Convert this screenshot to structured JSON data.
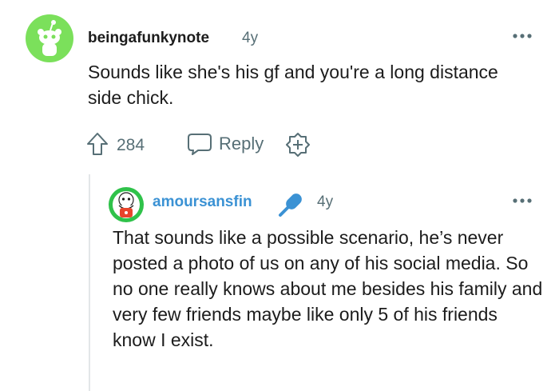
{
  "comment": {
    "author": "beingafunkynote",
    "age": "4y",
    "body": "Sounds like she's his gf and you're a long distance side chick.",
    "score": "284",
    "reply_label": "Reply",
    "avatar_color": "#7be05b"
  },
  "reply": {
    "author": "amoursansfin",
    "age": "4y",
    "body": "That sounds like a possible scenario, he’s never posted a photo of us on any of his social media. So no one really knows about me besides his family and very few friends maybe like only 5 of his friends know I exist.",
    "author_color": "#3b92d4",
    "badge_icon": "microphone-icon"
  },
  "colors": {
    "meta_text": "#576f76",
    "thread_line": "#e3e6e8"
  }
}
